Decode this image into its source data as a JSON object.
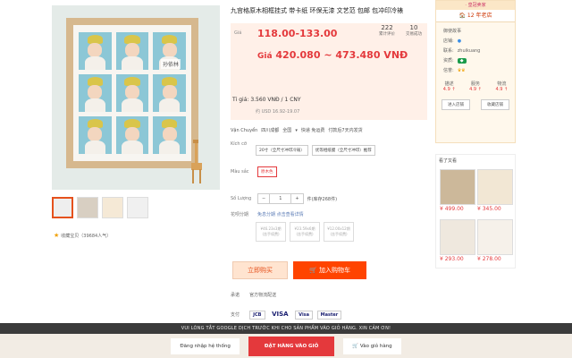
{
  "product": {
    "title": "九宫格原木相框挂式 带卡纸 环保无漆 文艺范 包邮 包冲印冷裱",
    "watermark": "孙依林",
    "favorites": "收藏宝贝（39684人气）"
  },
  "price": {
    "label": "Giá",
    "cny_range": "118.00-133.00",
    "reviews_count": "222",
    "reviews_label": "累计评价",
    "sales_count": "10",
    "sales_label": "交易成功",
    "vnd_prefix": "Giá",
    "vnd_range": "420.080 ~ 473.480 VNĐ",
    "exchange_rate": "Tỉ giá: 3.560 VNĐ / 1 CNY",
    "usd": "约 USD 16.92-19.07"
  },
  "shipping": {
    "label": "Vận Chuyển",
    "from": "四川成都",
    "to": "全国",
    "fee": "快递 免运费",
    "promise": "付款后7天内发货"
  },
  "size": {
    "label": "Kích cỡ",
    "options": [
      "20寸（全尺寸冲印冷裱）",
      "优等相纸膜（全尺寸冲印）推荐"
    ]
  },
  "color": {
    "label": "Màu sắc",
    "selected": "原木色"
  },
  "quantity": {
    "label": "Số Lượng",
    "minus": "−",
    "value": "1",
    "plus": "+",
    "stock": "件(库存268件)"
  },
  "service": {
    "label": "花呗分期",
    "note": "免息分期  点击查看详情  ",
    "plans": [
      "¥46.23x3期",
      "¥23.59x6期",
      "¥12.00x12期"
    ],
    "plan_sub": "(含手续费)"
  },
  "buttons": {
    "buy_now": "立即购买",
    "add_cart": "加入购物车"
  },
  "misc": {
    "guarantee_label": "承诺",
    "guarantee": "官方物流配送",
    "pay_label": "支付",
    "cards": [
      "JCB",
      "VISA",
      "Visa",
      "Master"
    ]
  },
  "seller": {
    "head": "· 皇冠卖家",
    "age": "12 年老店",
    "name": "御使故事",
    "shop_label": "店铺:",
    "contact_label": "联系:",
    "contact": "zhuikuang",
    "qual_label": "资质:",
    "credit_label": "信誉:",
    "score_labels": [
      "描述",
      "服务",
      "物流"
    ],
    "scores": [
      "4.9 ↑",
      "4.9 ↑",
      "4.9 ↑"
    ],
    "enter_shop": "进入店铺",
    "favorite_shop": "收藏店铺"
  },
  "seen": {
    "title": "看了又看",
    "prices": [
      "¥ 499.00",
      "¥ 345.00",
      "¥ 293.00",
      "¥ 278.00"
    ]
  },
  "footer": {
    "notice": "VUI LÒNG TẮT GOOGLE DỊCH TRƯỚC KHI CHO SẢN PHẨM VÀO GIỎ HÀNG. XIN CẢM ƠN!",
    "login": "Đăng nhập hệ thống",
    "order": "ĐẶT HÀNG VÀO GIỎ",
    "cart": "Vào giỏ hàng"
  },
  "colors": {
    "accent": "#e4393c",
    "orange": "#ff4400"
  }
}
